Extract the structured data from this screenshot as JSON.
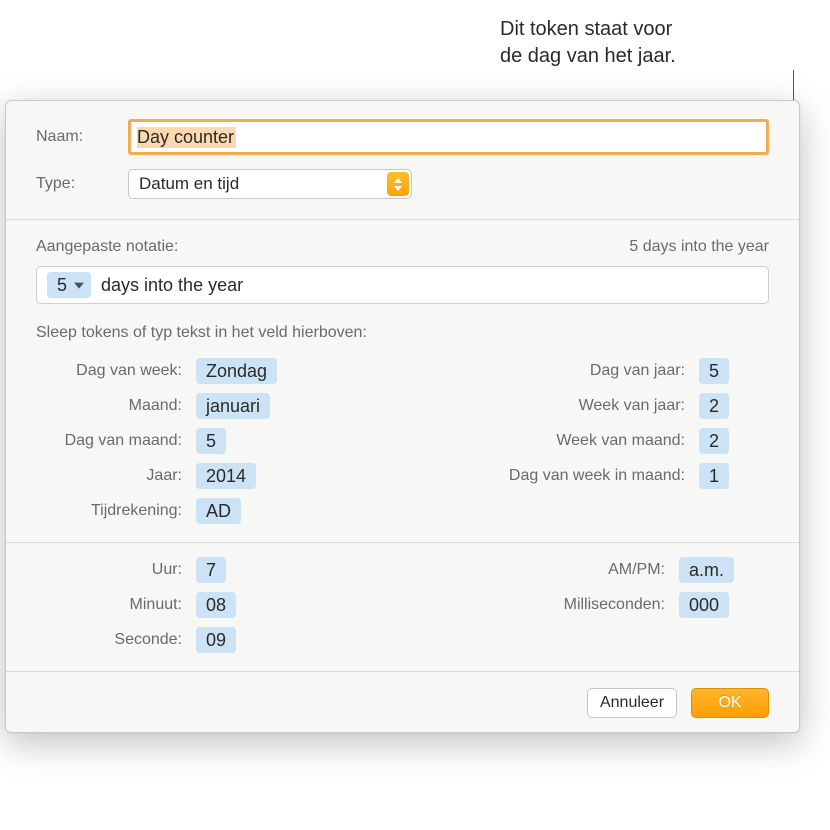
{
  "annotation": {
    "line1": "Dit token staat voor",
    "line2": "de dag van het jaar."
  },
  "dialog": {
    "name_label": "Naam:",
    "name_value": "Day counter",
    "type_label": "Type:",
    "type_value": "Datum en tijd",
    "custom_label": "Aangepaste notatie:",
    "preview": "5 days into the year",
    "format_token_value": "5",
    "format_text": "days into the year",
    "instruct": "Sleep tokens of typ tekst in het veld hierboven:",
    "left_tokens": [
      {
        "label": "Dag van week:",
        "value": "Zondag"
      },
      {
        "label": "Maand:",
        "value": "januari"
      },
      {
        "label": "Dag van maand:",
        "value": "5"
      },
      {
        "label": "Jaar:",
        "value": "2014"
      },
      {
        "label": "Tijdrekening:",
        "value": "AD"
      }
    ],
    "right_tokens": [
      {
        "label": "Dag van jaar:",
        "value": "5"
      },
      {
        "label": "Week van jaar:",
        "value": "2"
      },
      {
        "label": "Week van maand:",
        "value": "2"
      },
      {
        "label": "Dag van week in maand:",
        "value": "1"
      }
    ],
    "time_left": [
      {
        "label": "Uur:",
        "value": "7"
      },
      {
        "label": "Minuut:",
        "value": "08"
      },
      {
        "label": "Seconde:",
        "value": "09"
      }
    ],
    "time_right": [
      {
        "label": "AM/PM:",
        "value": "a.m."
      },
      {
        "label": "Milliseconden:",
        "value": "000"
      }
    ],
    "cancel": "Annuleer",
    "ok": "OK"
  }
}
